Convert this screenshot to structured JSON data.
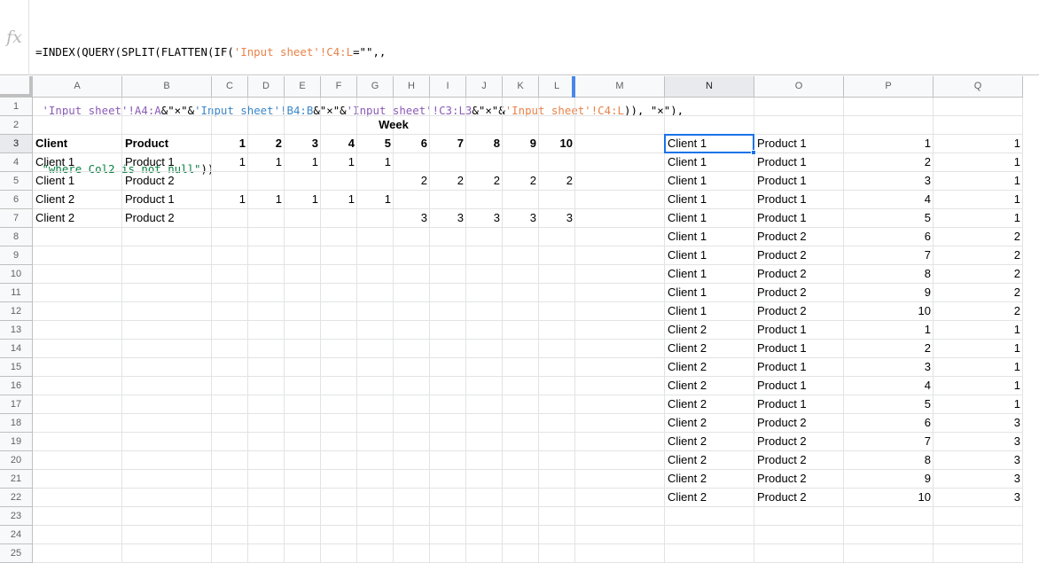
{
  "formula_bar": {
    "icon": "fx-icon",
    "fx_label": "fx",
    "line1": [
      {
        "t": "=INDEX(QUERY(SPLIT(FLATTEN(IF(",
        "c": ""
      },
      {
        "t": "'Input sheet'!C4:L",
        "c": "rng"
      },
      {
        "t": "=\"\",,",
        "c": ""
      }
    ],
    "line2": [
      {
        "t": " ",
        "c": ""
      },
      {
        "t": "'Input sheet'!A4:A",
        "c": "rng3"
      },
      {
        "t": "&\"×\"&",
        "c": ""
      },
      {
        "t": "'Input sheet'!B4:B",
        "c": "rng2"
      },
      {
        "t": "&\"×\"&",
        "c": ""
      },
      {
        "t": "'Input sheet'!C3:L3",
        "c": "rng3"
      },
      {
        "t": "&\"×\"&",
        "c": ""
      },
      {
        "t": "'Input sheet'!C4:L",
        "c": "rng"
      },
      {
        "t": ")), \"×\"),",
        "c": ""
      }
    ],
    "line3": [
      {
        "t": " ",
        "c": ""
      },
      {
        "t": "\"where Col2 is not null\"",
        "c": "str"
      },
      {
        "t": "))",
        "c": ""
      }
    ]
  },
  "columns": [
    "A",
    "B",
    "C",
    "D",
    "E",
    "F",
    "G",
    "H",
    "I",
    "J",
    "K",
    "L",
    "M",
    "N",
    "O",
    "P",
    "Q"
  ],
  "rows": [
    "1",
    "2",
    "3",
    "4",
    "5",
    "6",
    "7",
    "8",
    "9",
    "10",
    "11",
    "12",
    "13",
    "14",
    "15",
    "16",
    "17",
    "18",
    "19",
    "20",
    "21",
    "22",
    "23",
    "24",
    "25"
  ],
  "selected_column": "N",
  "selected_row": "3",
  "input_table": {
    "week_label": "Week",
    "header": {
      "client": "Client",
      "product": "Product",
      "weeks": [
        "1",
        "2",
        "3",
        "4",
        "5",
        "6",
        "7",
        "8",
        "9",
        "10"
      ]
    },
    "rows": [
      {
        "client": "Client 1",
        "product": "Product 1",
        "values": [
          "1",
          "1",
          "1",
          "1",
          "1",
          "",
          "",
          "",
          "",
          ""
        ]
      },
      {
        "client": "Client 1",
        "product": "Product 2",
        "values": [
          "",
          "",
          "",
          "",
          "",
          "2",
          "2",
          "2",
          "2",
          "2"
        ]
      },
      {
        "client": "Client 2",
        "product": "Product 1",
        "values": [
          "1",
          "1",
          "1",
          "1",
          "1",
          "",
          "",
          "",
          "",
          ""
        ]
      },
      {
        "client": "Client 2",
        "product": "Product 2",
        "values": [
          "",
          "",
          "",
          "",
          "",
          "3",
          "3",
          "3",
          "3",
          "3"
        ]
      }
    ]
  },
  "output_table": [
    [
      "Client 1",
      "Product 1",
      "1",
      "1"
    ],
    [
      "Client 1",
      "Product 1",
      "2",
      "1"
    ],
    [
      "Client 1",
      "Product 1",
      "3",
      "1"
    ],
    [
      "Client 1",
      "Product 1",
      "4",
      "1"
    ],
    [
      "Client 1",
      "Product 1",
      "5",
      "1"
    ],
    [
      "Client 1",
      "Product 2",
      "6",
      "2"
    ],
    [
      "Client 1",
      "Product 2",
      "7",
      "2"
    ],
    [
      "Client 1",
      "Product 2",
      "8",
      "2"
    ],
    [
      "Client 1",
      "Product 2",
      "9",
      "2"
    ],
    [
      "Client 1",
      "Product 2",
      "10",
      "2"
    ],
    [
      "Client 2",
      "Product 1",
      "1",
      "1"
    ],
    [
      "Client 2",
      "Product 1",
      "2",
      "1"
    ],
    [
      "Client 2",
      "Product 1",
      "3",
      "1"
    ],
    [
      "Client 2",
      "Product 1",
      "4",
      "1"
    ],
    [
      "Client 2",
      "Product 1",
      "5",
      "1"
    ],
    [
      "Client 2",
      "Product 2",
      "6",
      "3"
    ],
    [
      "Client 2",
      "Product 2",
      "7",
      "3"
    ],
    [
      "Client 2",
      "Product 2",
      "8",
      "3"
    ],
    [
      "Client 2",
      "Product 2",
      "9",
      "3"
    ],
    [
      "Client 2",
      "Product 2",
      "10",
      "3"
    ]
  ],
  "colors": {
    "selection": "#1a73e8",
    "freeze_line": "#4a86e8"
  }
}
